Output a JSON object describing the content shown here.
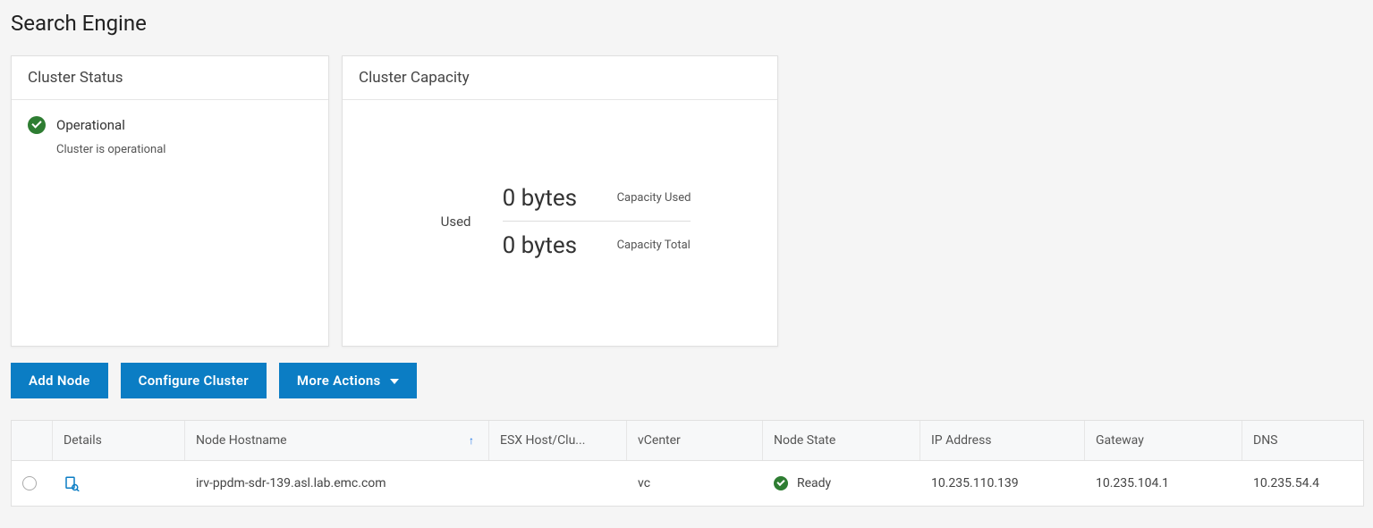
{
  "page": {
    "title": "Search Engine"
  },
  "cards": {
    "status": {
      "title": "Cluster Status",
      "state": "Operational",
      "subtext": "Cluster is operational"
    },
    "capacity": {
      "title": "Cluster Capacity",
      "used_label": "Used",
      "used_value": "0 bytes",
      "used_caption": "Capacity Used",
      "total_value": "0 bytes",
      "total_caption": "Capacity Total"
    }
  },
  "actions": {
    "add_node": "Add Node",
    "configure": "Configure Cluster",
    "more": "More Actions"
  },
  "table": {
    "headers": {
      "details": "Details",
      "hostname": "Node Hostname",
      "esx": "ESX Host/Clu...",
      "vcenter": "vCenter",
      "state": "Node State",
      "ip": "IP Address",
      "gateway": "Gateway",
      "dns": "DNS"
    },
    "rows": [
      {
        "hostname": "irv-ppdm-sdr-139.asl.lab.emc.com",
        "esx": "",
        "vcenter": "vc",
        "state": "Ready",
        "ip": "10.235.110.139",
        "gateway": "10.235.104.1",
        "dns": "10.235.54.4"
      }
    ]
  }
}
